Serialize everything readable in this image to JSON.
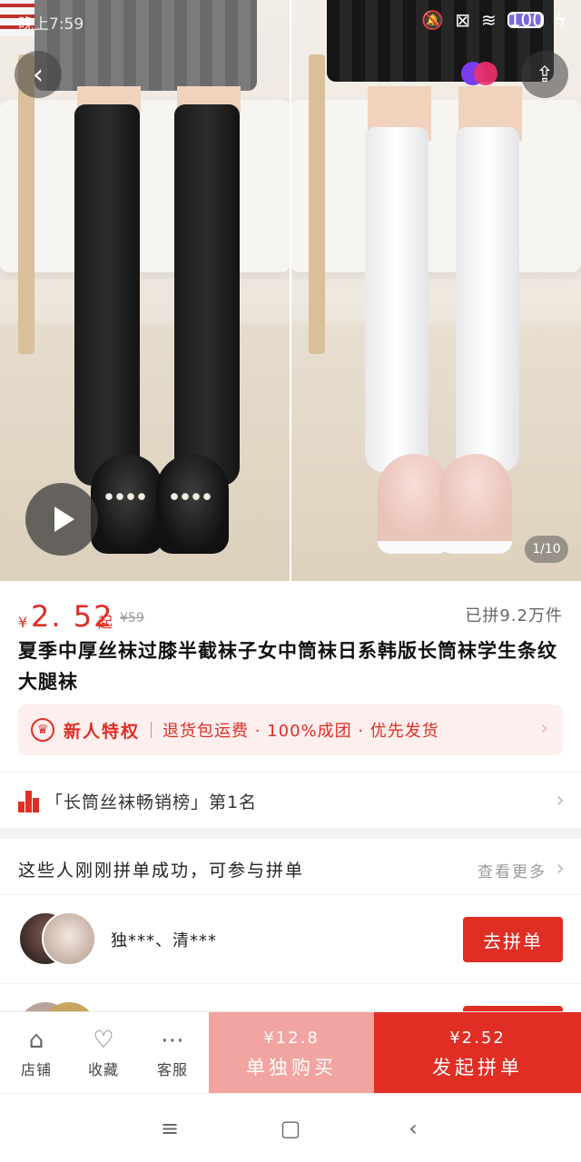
{
  "status_bar": {
    "time": "晚上7:59",
    "battery": "100"
  },
  "gallery": {
    "counter": "1/10"
  },
  "product": {
    "price_currency": "¥",
    "price": "2. 52",
    "price_suffix": "起",
    "original_price": "¥59",
    "sold": "已拼9.2万件",
    "title": "夏季中厚丝袜过膝半截袜子女中筒袜日系韩版长筒袜学生条纹大腿袜"
  },
  "privilege": {
    "title": "新人特权",
    "benefits": "退货包运费 · 100%成团 · 优先发货"
  },
  "ranking": {
    "text": "「长筒丝袜畅销榜」第1名"
  },
  "group_buy": {
    "title": "这些人刚刚拼单成功，可参与拼单",
    "more": "查看更多",
    "rows": [
      {
        "names": "独***、清***",
        "button": "去拼单"
      }
    ]
  },
  "action_bar": {
    "store": "店铺",
    "favorite": "收藏",
    "service": "客服",
    "buy_alone_price": "¥12.8",
    "buy_alone_label": "单独购买",
    "buy_group_price": "¥2.52",
    "buy_group_label": "发起拼单"
  },
  "colors": {
    "accent": "#e02e24",
    "accent_light": "#f2a4a0",
    "privilege_bg": "#fcefee"
  },
  "icons": {
    "back": "chevron-left-icon",
    "share": "share-icon",
    "play": "play-icon",
    "crown": "crown-icon",
    "rank": "bar-chart-icon",
    "store": "store-icon",
    "favorite": "heart-icon",
    "service": "chat-icon"
  }
}
